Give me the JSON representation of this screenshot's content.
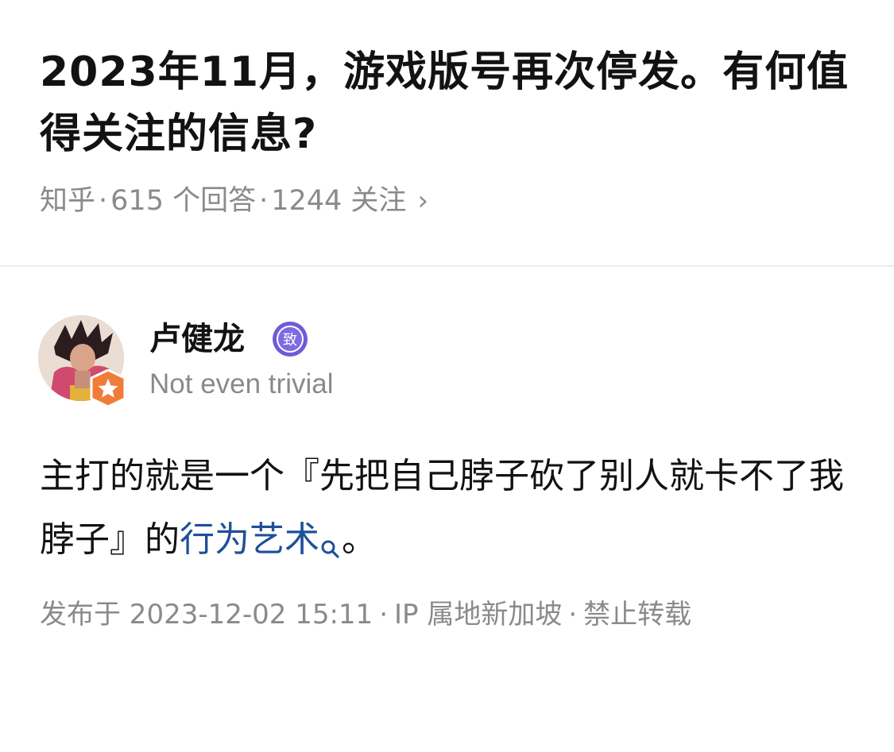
{
  "question": {
    "title": "2023年11月，游戏版号再次停发。有何值得关注的信息?",
    "source": "知乎",
    "answers_count": "615 个回答",
    "followers_count": "1244 关注",
    "separator": "·",
    "chevron": "›"
  },
  "author": {
    "name": "卢健龙",
    "level_badge_text": "致",
    "signature": "Not even trivial"
  },
  "answer": {
    "text_before": "主打的就是一个『先把自己脖子砍了别人就卡不了我脖子』的",
    "link_text": "行为艺术",
    "text_after": "。"
  },
  "footer": {
    "published": "发布于 2023-12-02 15:11",
    "ip_location": "IP 属地新加坡",
    "copyright": "禁止转载",
    "separator": "·"
  },
  "colors": {
    "text": "#121212",
    "meta": "#8a8a8a",
    "link": "#1e4f9a",
    "badge_purple": "#6f5bd6",
    "badge_orange": "#f07c3a"
  },
  "icons": {
    "avatar_badge": "star-badge-icon",
    "level_badge": "level-badge-icon",
    "search_link": "search-icon",
    "chevron": "chevron-right-icon"
  }
}
